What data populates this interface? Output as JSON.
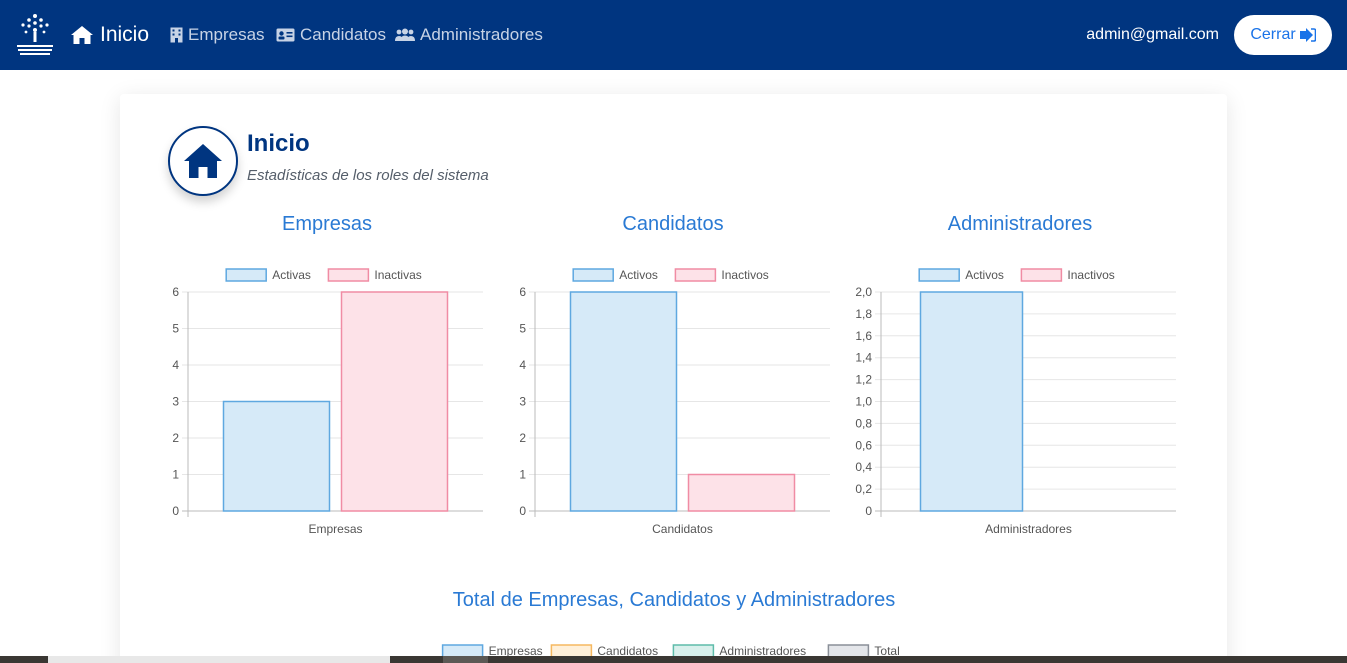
{
  "navbar": {
    "brand_label": "Inicio",
    "links": [
      "Empresas",
      "Candidatos",
      "Administradores"
    ],
    "user_email": "admin@gmail.com",
    "logout_label": "Cerrar",
    "background_color": "#003580"
  },
  "header": {
    "title": "Inicio",
    "subtitle": "Estadísticas de los roles del sistema"
  },
  "chart_data": [
    {
      "type": "bar",
      "title": "Empresas",
      "categories": [
        "Empresas"
      ],
      "series": [
        {
          "name": "Activas",
          "values": [
            3
          ],
          "fill": "#d6eaf8",
          "stroke": "#5fa8e0"
        },
        {
          "name": "Inactivas",
          "values": [
            6
          ],
          "fill": "#fde2e8",
          "stroke": "#f08ca4"
        }
      ],
      "ylim": [
        0,
        6
      ],
      "yticks": [
        "0",
        "1",
        "2",
        "3",
        "4",
        "5",
        "6"
      ],
      "legend": "top"
    },
    {
      "type": "bar",
      "title": "Candidatos",
      "categories": [
        "Candidatos"
      ],
      "series": [
        {
          "name": "Activos",
          "values": [
            6
          ],
          "fill": "#d6eaf8",
          "stroke": "#5fa8e0"
        },
        {
          "name": "Inactivos",
          "values": [
            1
          ],
          "fill": "#fde2e8",
          "stroke": "#f08ca4"
        }
      ],
      "ylim": [
        0,
        6
      ],
      "yticks": [
        "0",
        "1",
        "2",
        "3",
        "4",
        "5",
        "6"
      ],
      "legend": "top"
    },
    {
      "type": "bar",
      "title": "Administradores",
      "categories": [
        "Administradores"
      ],
      "series": [
        {
          "name": "Activos",
          "values": [
            2
          ],
          "fill": "#d6eaf8",
          "stroke": "#5fa8e0"
        },
        {
          "name": "Inactivos",
          "values": [
            0
          ],
          "fill": "#fde2e8",
          "stroke": "#f08ca4"
        }
      ],
      "ylim": [
        0,
        2
      ],
      "yticks": [
        "0",
        "0,2",
        "0,4",
        "0,6",
        "0,8",
        "1,0",
        "1,2",
        "1,4",
        "1,6",
        "1,8",
        "2,0"
      ],
      "legend": "top"
    },
    {
      "type": "bar",
      "title": "Total de Empresas, Candidatos y Administradores",
      "series": [
        {
          "name": "Empresas",
          "fill": "#d6eaf8",
          "stroke": "#5fa8e0"
        },
        {
          "name": "Candidatos",
          "fill": "#fff0d9",
          "stroke": "#f5b860"
        },
        {
          "name": "Administradores",
          "fill": "#d9f0ec",
          "stroke": "#5ebcaa"
        },
        {
          "name": "Total",
          "fill": "#e4e6ea",
          "stroke": "#8a8f98"
        }
      ],
      "legend": "top"
    }
  ],
  "colors": {
    "title_blue": "#2a7ad4",
    "navy": "#003580"
  }
}
